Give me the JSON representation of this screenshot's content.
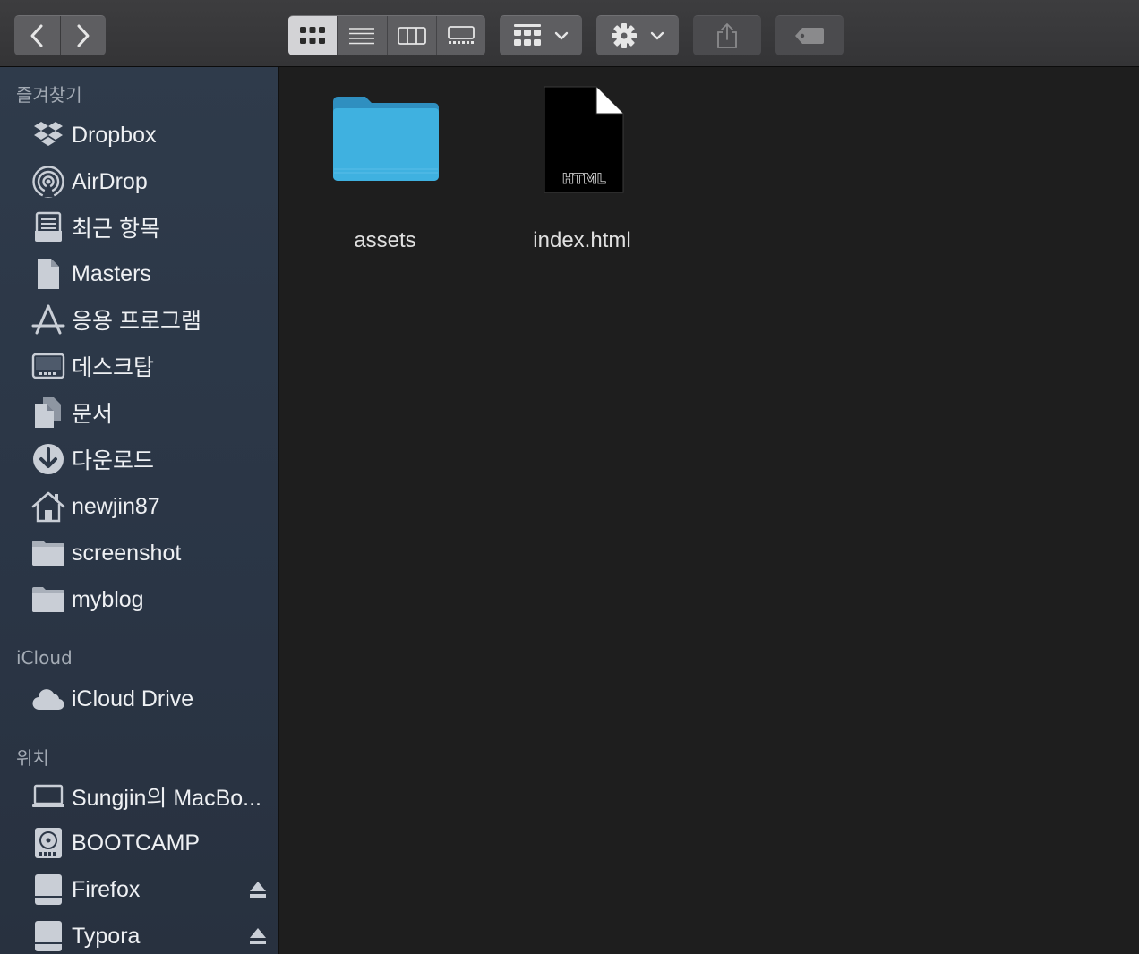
{
  "toolbar": {
    "back_icon": "chevron-left-icon",
    "forward_icon": "chevron-right-icon",
    "view_modes": [
      "icon-view",
      "list-view",
      "column-view",
      "gallery-view"
    ],
    "active_view": "icon-view",
    "group_icon": "group-grid-icon",
    "action_icon": "gear-icon",
    "share_icon": "share-icon",
    "tag_icon": "tag-icon"
  },
  "sidebar": {
    "favorites_title": "즐겨찾기",
    "favorites": [
      {
        "label": "Dropbox",
        "icon": "dropbox-icon"
      },
      {
        "label": "AirDrop",
        "icon": "airdrop-icon"
      },
      {
        "label": "최근 항목",
        "icon": "recents-icon"
      },
      {
        "label": "Masters",
        "icon": "document-icon"
      },
      {
        "label": "응용 프로그램",
        "icon": "applications-icon"
      },
      {
        "label": "데스크탑",
        "icon": "desktop-icon"
      },
      {
        "label": "문서",
        "icon": "documents-icon"
      },
      {
        "label": "다운로드",
        "icon": "downloads-icon"
      },
      {
        "label": "newjin87",
        "icon": "home-icon"
      },
      {
        "label": "screenshot",
        "icon": "folder-icon"
      },
      {
        "label": "myblog",
        "icon": "folder-icon"
      }
    ],
    "icloud_title": "iCloud",
    "icloud": [
      {
        "label": "iCloud Drive",
        "icon": "cloud-icon"
      }
    ],
    "locations_title": "위치",
    "locations": [
      {
        "label": "Sungjin의 MacBo...",
        "icon": "laptop-icon"
      },
      {
        "label": "BOOTCAMP",
        "icon": "internal-disk-icon"
      },
      {
        "label": "Firefox",
        "icon": "external-disk-icon",
        "ejectable": true
      },
      {
        "label": "Typora",
        "icon": "external-disk-icon",
        "ejectable": true
      }
    ]
  },
  "content": {
    "files": [
      {
        "name": "assets",
        "kind": "folder",
        "icon": "folder-icon"
      },
      {
        "name": "index.html",
        "kind": "html",
        "icon": "html-file-icon",
        "badge": "HTML"
      }
    ]
  },
  "colors": {
    "folder_blue": "#3fa9d9",
    "sidebar_bg": "#2f3b4b",
    "content_bg": "#1e1e1e",
    "toolbar_bg": "#3d3d3f"
  }
}
